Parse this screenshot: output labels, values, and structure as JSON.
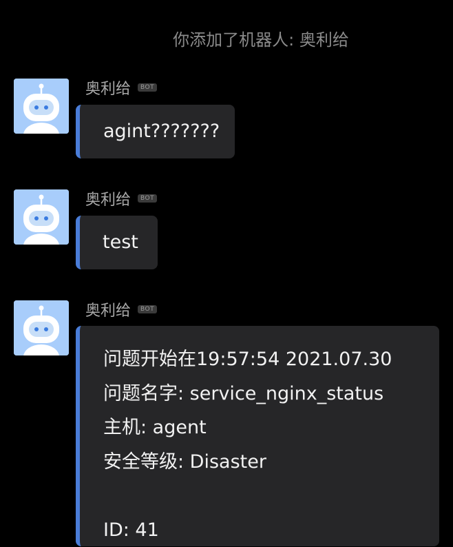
{
  "system_notice": "你添加了机器人:  奥利给",
  "messages": [
    {
      "sender": "奥利给",
      "badge": "BOT",
      "text": "agint???????"
    },
    {
      "sender": "奥利给",
      "badge": "BOT",
      "text": "test"
    },
    {
      "sender": "奥利给",
      "badge": "BOT",
      "lines": [
        "问题开始在19:57:54 2021.07.30",
        "问题名字: service_nginx_status",
        "主机: agent",
        "安全等级: Disaster",
        "",
        "ID: 41"
      ]
    }
  ],
  "colors": {
    "background": "#000000",
    "bubble": "#262628",
    "accent_bar": "#4a7dd8",
    "avatar_bg": "#a8cdfb",
    "muted_text": "#8a8a8a"
  },
  "icons": {
    "avatar": "robot-avatar-icon"
  }
}
